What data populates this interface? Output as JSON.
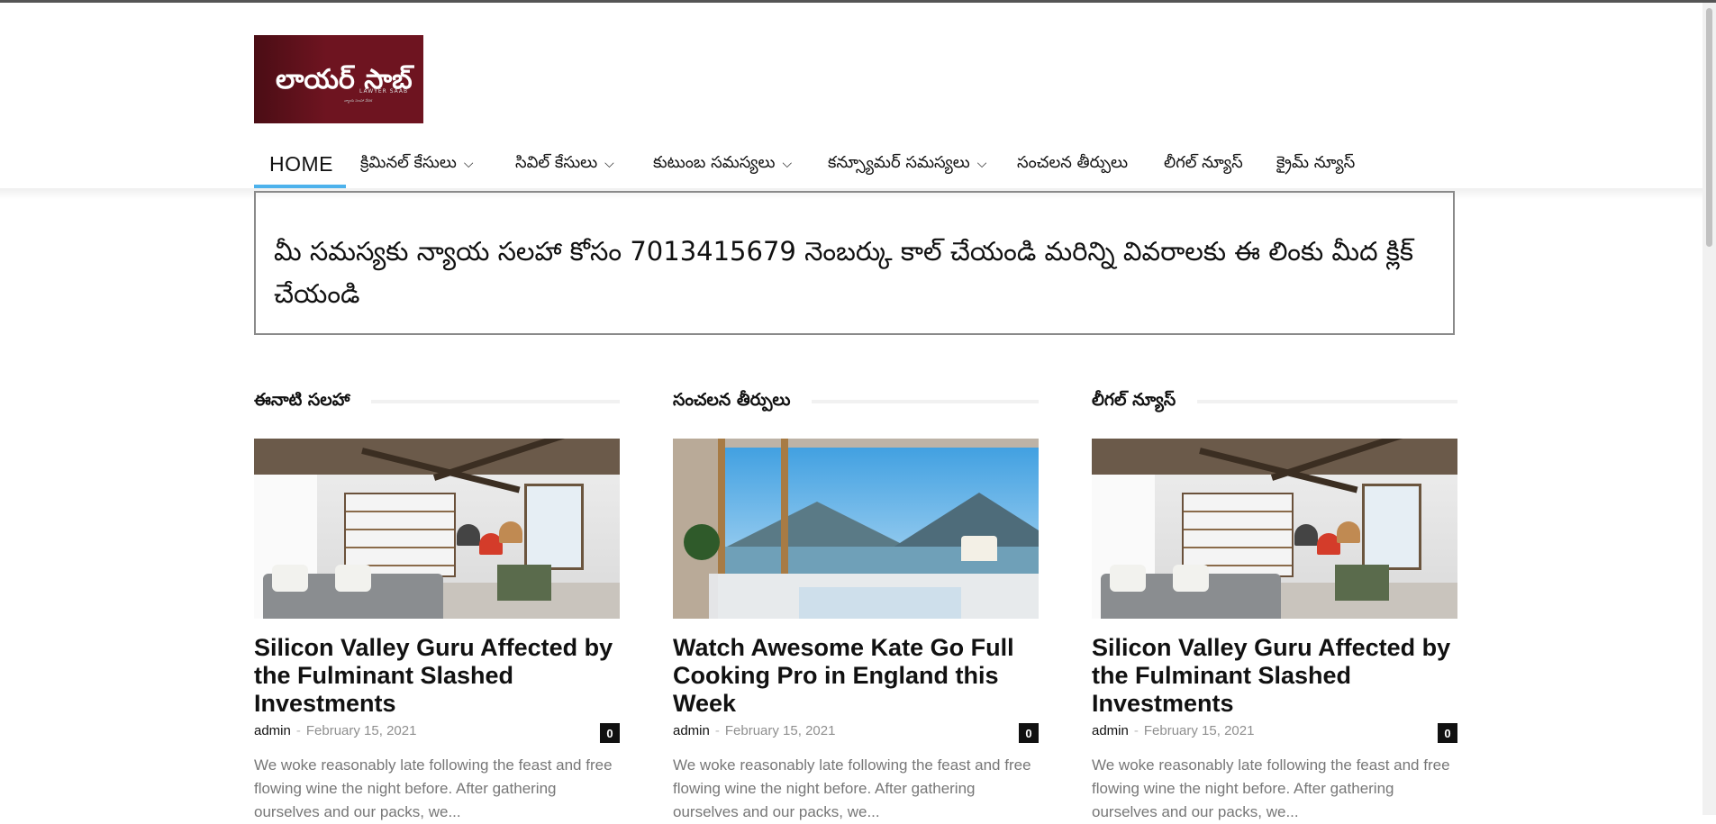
{
  "logo": {
    "main_text": "లాయర్ సాబ్",
    "sub_text": "LAWYER SAAB",
    "tiny_text": "న్యాయ సలహా వేదిక",
    "bg_color": "#6e1420"
  },
  "nav": {
    "items": [
      {
        "label": "HOME",
        "has_dropdown": false,
        "active": true
      },
      {
        "label": "క్రిమినల్ కేసులు",
        "has_dropdown": true
      },
      {
        "label": "సివిల్ కేసులు",
        "has_dropdown": true
      },
      {
        "label": "కుటుంబ సమస్యలు",
        "has_dropdown": true
      },
      {
        "label": "కన్స్యూమర్ సమస్యలు",
        "has_dropdown": true
      },
      {
        "label": "సంచలన తీర్పులు",
        "has_dropdown": false
      },
      {
        "label": "లీగల్ న్యూస్",
        "has_dropdown": false
      },
      {
        "label": "క్రైమ్ న్యూస్",
        "has_dropdown": false
      }
    ],
    "chevron_icon": "chevron-down-icon",
    "active_color": "#4db2ec"
  },
  "notice": {
    "text": "మీ సమస్యకు న్యాయ సలహా కోసం 7013415679 నెంబర్కు కాల్ చేయండి మరిన్ని వివరాలకు  ఈ లింకు మీద క్లిక్ చేయండి"
  },
  "columns": [
    {
      "heading": "ఈనాటి సలహా",
      "post": {
        "title": "Silicon Valley Guru Affected by the Fulminant Slashed Investments",
        "author": "admin",
        "date": "February 15, 2021",
        "comments": "0",
        "excerpt": "We woke reasonably late following the feast and free flowing wine the night before. After gathering ourselves and our packs, we...",
        "image": "interior-living-room"
      }
    },
    {
      "heading": "సంచలన తీర్పులు",
      "post": {
        "title": "Watch Awesome Kate Go Full Cooking Pro in England this Week",
        "author": "admin",
        "date": "February 15, 2021",
        "comments": "0",
        "excerpt": "We woke reasonably late following the feast and free flowing wine the night before. After gathering ourselves and our packs, we...",
        "image": "lake-view-room"
      }
    },
    {
      "heading": "లీగల్ న్యూస్",
      "post": {
        "title": "Silicon Valley Guru Affected by the Fulminant Slashed Investments",
        "author": "admin",
        "date": "February 15, 2021",
        "comments": "0",
        "excerpt": "We woke reasonably late following the feast and free flowing wine the night before. After gathering ourselves and our packs, we...",
        "image": "interior-living-room"
      }
    }
  ],
  "meta_separator": "-"
}
